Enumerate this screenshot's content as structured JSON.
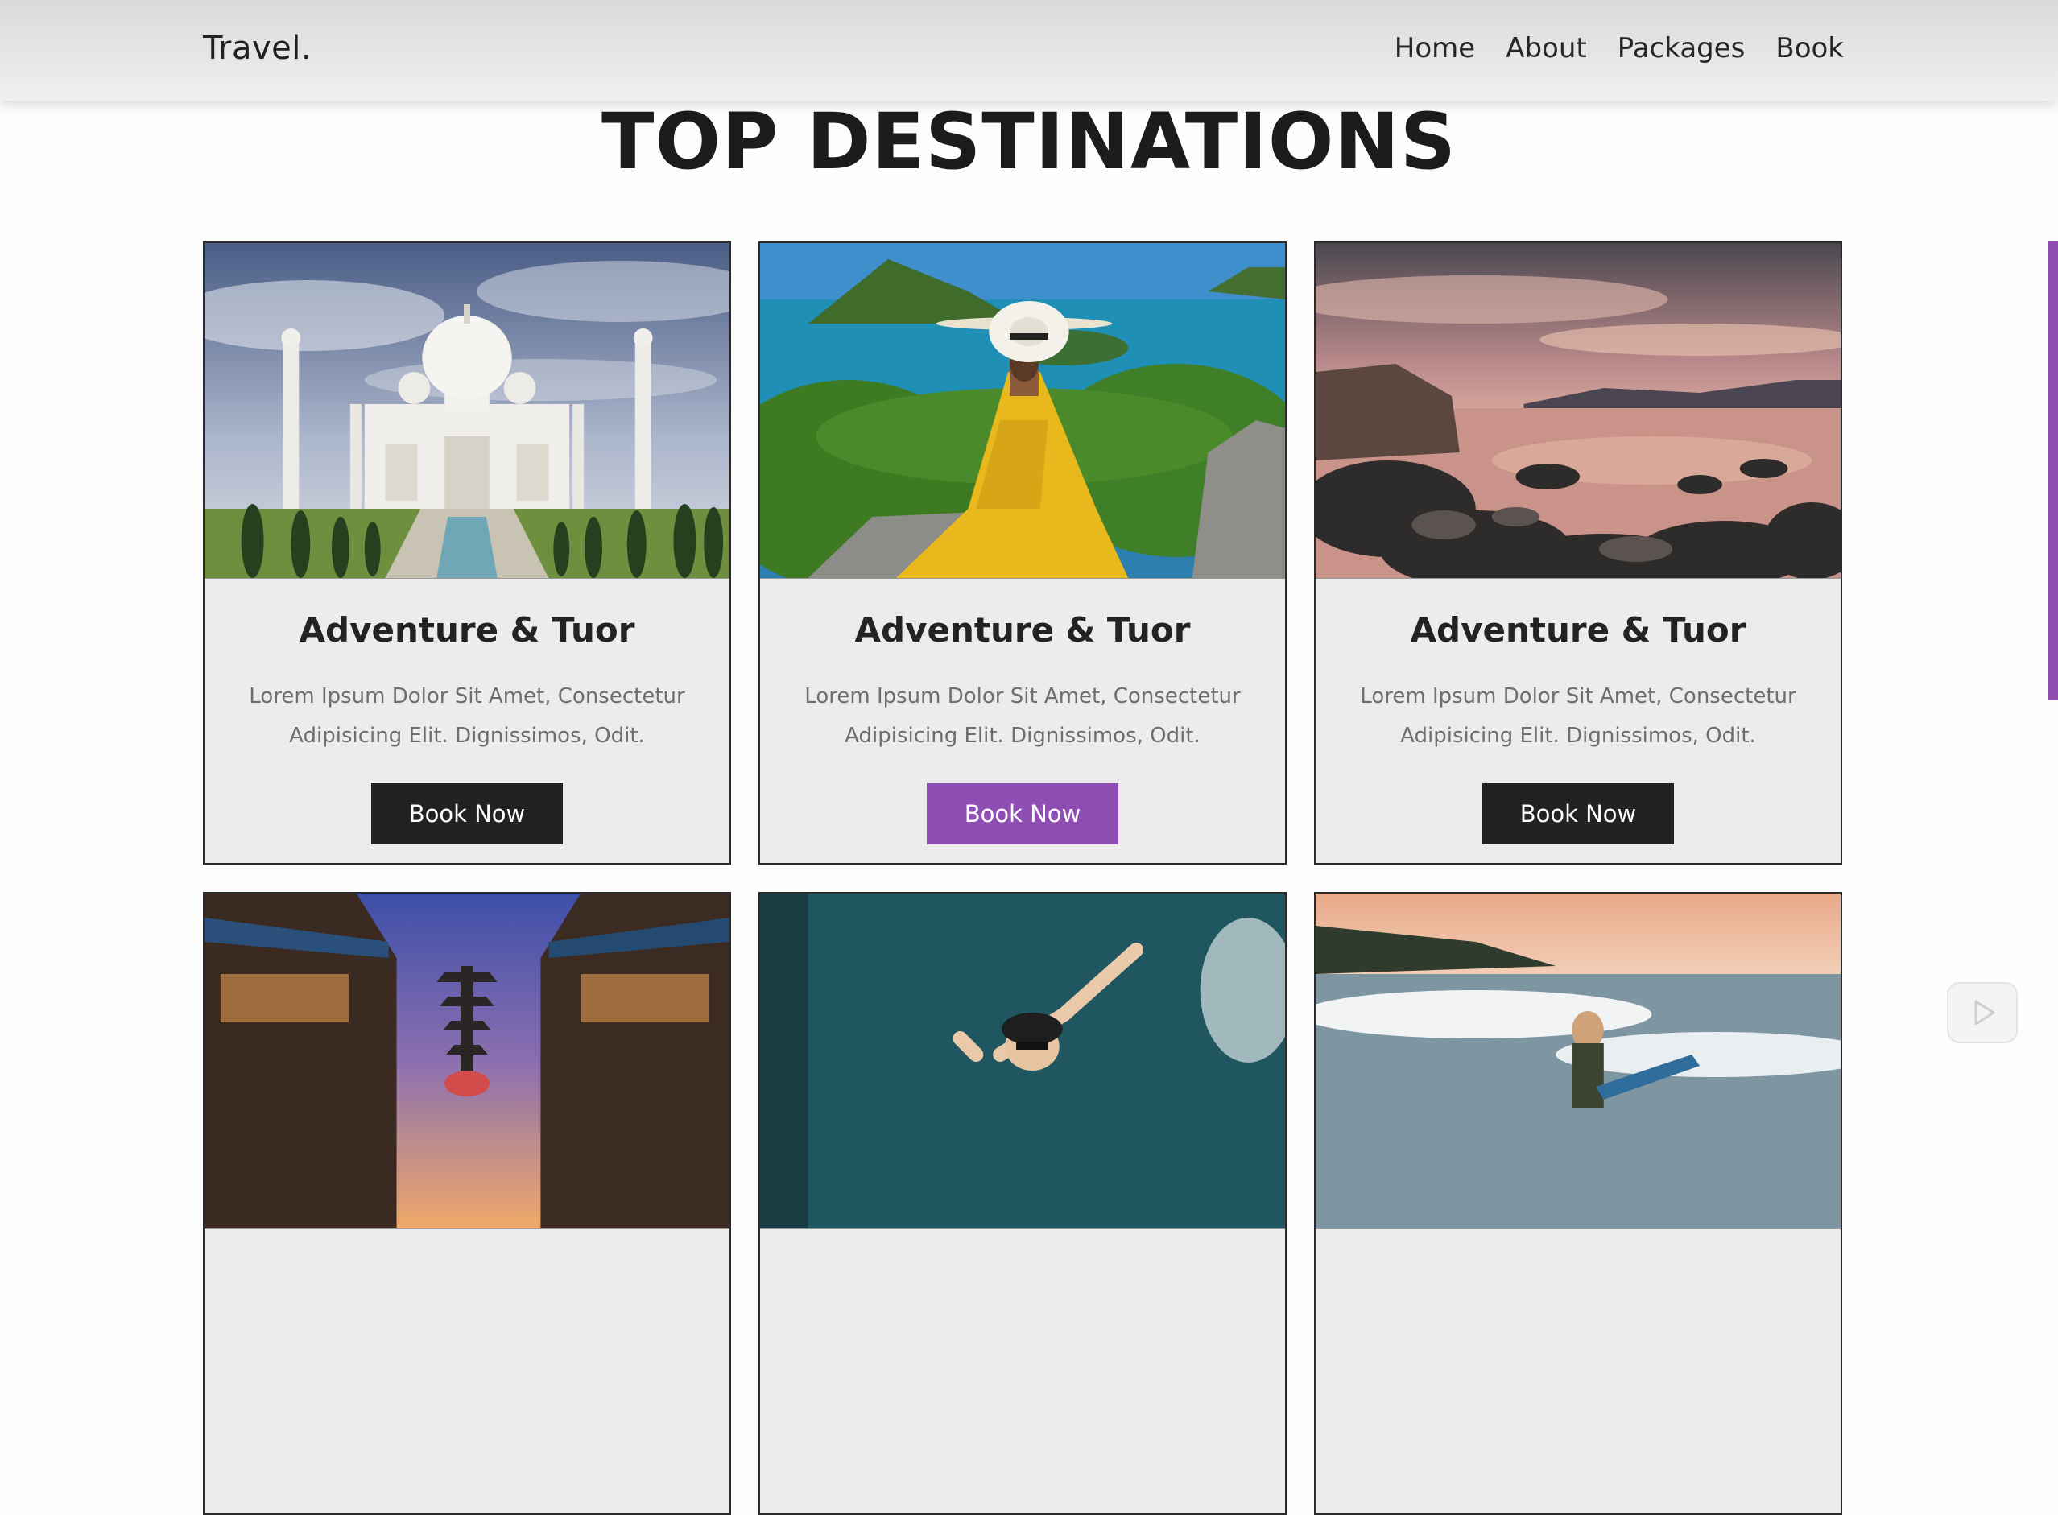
{
  "header": {
    "logo": "Travel.",
    "nav": [
      "Home",
      "About",
      "Packages",
      "Book"
    ]
  },
  "page_title": "TOP DESTINATIONS",
  "cards": [
    {
      "title": "Adventure & Tuor",
      "text": "Lorem Ipsum Dolor Sit Amet, Consectetur Adipisicing Elit. Dignissimos, Odit.",
      "button": "Book Now",
      "image": "taj-mahal"
    },
    {
      "title": "Adventure & Tuor",
      "text": "Lorem Ipsum Dolor Sit Amet, Consectetur Adipisicing Elit. Dignissimos, Odit.",
      "button": "Book Now",
      "image": "woman-yellow-dress-island"
    },
    {
      "title": "Adventure & Tuor",
      "text": "Lorem Ipsum Dolor Sit Amet, Consectetur Adipisicing Elit. Dignissimos, Odit.",
      "button": "Book Now",
      "image": "rocky-shore-sunset"
    },
    {
      "image": "kyoto-street-pagoda"
    },
    {
      "image": "traveler-arms-raised"
    },
    {
      "image": "surfer-wave"
    }
  ],
  "colors": {
    "accent": "#8e4eb4",
    "button_dark": "#212322",
    "card_bg": "#ececec"
  },
  "icons": {
    "player_badge": "play-icon"
  }
}
